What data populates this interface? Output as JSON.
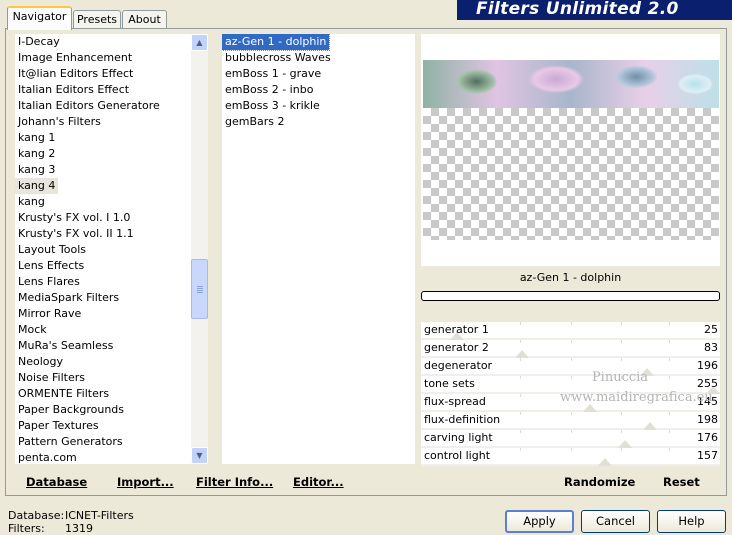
{
  "app": {
    "title": "Filters Unlimited 2.0"
  },
  "tabs": [
    {
      "label": "Navigator",
      "active": true
    },
    {
      "label": "Presets",
      "active": false
    },
    {
      "label": "About",
      "active": false
    }
  ],
  "categories": {
    "items": [
      "I-Decay",
      "Image Enhancement",
      "It@lian Editors Effect",
      "Italian Editors Effect",
      "Italian Editors Generatore",
      "Johann's Filters",
      "kang 1",
      "kang 2",
      "kang 3",
      "kang 4",
      "kang",
      "Krusty's FX vol. I 1.0",
      "Krusty's FX vol. II 1.1",
      "Layout Tools",
      "Lens Effects",
      "Lens Flares",
      "MediaSpark Filters",
      "Mirror Rave",
      "Mock",
      "MuRa's Seamless",
      "Neology",
      "Noise Filters",
      "ORMENTE Filters",
      "Paper Backgrounds",
      "Paper Textures",
      "Pattern Generators",
      "penta.com"
    ],
    "selected": "kang 4",
    "scroll_position": 0.62
  },
  "filters": {
    "items": [
      "az-Gen 1  -  dolphin",
      "bubblecross Waves",
      "emBoss 1  -  grave",
      "emBoss 2  -  inbo",
      "emBoss 3  -  krikle",
      "gemBars 2"
    ],
    "selected": "az-Gen 1  -  dolphin"
  },
  "preview": {
    "filter_name": "az-Gen 1  -  dolphin",
    "progress": 0
  },
  "parameters": [
    {
      "label": "generator 1",
      "value": "25",
      "level": 0.1
    },
    {
      "label": "generator 2",
      "value": "83",
      "level": 0.33
    },
    {
      "label": "degenerator",
      "value": "196",
      "level": 0.77
    },
    {
      "label": "tone sets",
      "value": "255",
      "level": 1.0
    },
    {
      "label": "flux-spread",
      "value": "145",
      "level": 0.57
    },
    {
      "label": "flux-definition",
      "value": "198",
      "level": 0.78
    },
    {
      "label": "carving light",
      "value": "176",
      "level": 0.69
    },
    {
      "label": "control light",
      "value": "157",
      "level": 0.62
    }
  ],
  "watermark": {
    "line1": "Pinuccia",
    "line2": "www.maidiregrafica.eu"
  },
  "toolbar": {
    "database": "Database",
    "import": "Import...",
    "filter_info": "Filter Info...",
    "editor": "Editor...",
    "randomize": "Randomize",
    "reset": "Reset"
  },
  "footer": {
    "database_label": "Database:",
    "database_value": "ICNET-Filters",
    "filters_label": "Filters:",
    "filters_value": "1319"
  },
  "buttons": {
    "apply": "Apply",
    "cancel": "Cancel",
    "help": "Help"
  },
  "colors": {
    "banner": "#0a1f6e",
    "selection": "#316ac5",
    "window_bg": "#ece9d8"
  }
}
